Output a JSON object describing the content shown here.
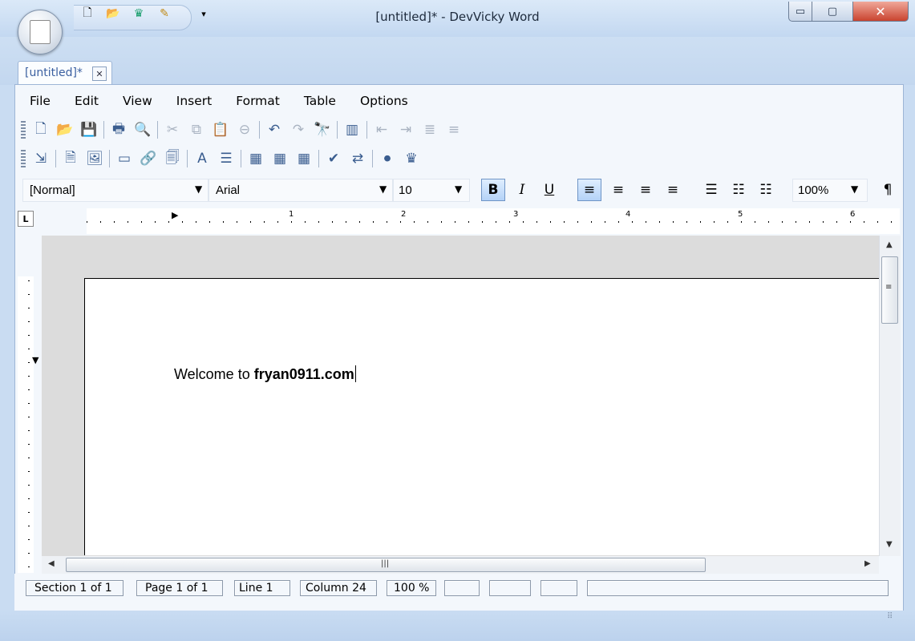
{
  "window": {
    "title": "[untitled]* - DevVicky Word",
    "buttons": {
      "minimize": "▭",
      "maximize": "▢",
      "close": "✕"
    }
  },
  "quick_access": {
    "icons": [
      "new-document-icon",
      "open-icon",
      "devvicky-logo-icon",
      "edit-icon",
      "customize-dropdown-icon"
    ],
    "glyphs": [
      "🗋",
      "📂",
      "♛",
      "✎",
      "▾"
    ]
  },
  "tabs": [
    {
      "label": "[untitled]*",
      "close": "✕"
    }
  ],
  "menu": {
    "items": [
      "File",
      "Edit",
      "View",
      "Insert",
      "Format",
      "Table",
      "Options"
    ]
  },
  "toolbar1": {
    "buttons": [
      {
        "name": "new-icon",
        "glyph": "🗋",
        "dim": false
      },
      {
        "name": "open-icon",
        "glyph": "📂",
        "dim": false
      },
      {
        "name": "save-icon",
        "glyph": "💾",
        "dim": false
      },
      {
        "name": "print-icon",
        "glyph": "🖶",
        "dim": false
      },
      {
        "name": "print-preview-icon",
        "glyph": "🔍",
        "dim": false
      },
      {
        "name": "cut-icon",
        "glyph": "✂",
        "dim": true
      },
      {
        "name": "copy-icon",
        "glyph": "⧉",
        "dim": true
      },
      {
        "name": "paste-icon",
        "glyph": "📋",
        "dim": false
      },
      {
        "name": "delete-icon",
        "glyph": "⊖",
        "dim": true
      },
      {
        "name": "undo-icon",
        "glyph": "↶",
        "dim": false
      },
      {
        "name": "redo-icon",
        "glyph": "↷",
        "dim": true
      },
      {
        "name": "find-icon",
        "glyph": "🔭",
        "dim": false
      },
      {
        "name": "columns-icon",
        "glyph": "▥",
        "dim": false
      },
      {
        "name": "indent-icon",
        "glyph": "⇤",
        "dim": true
      },
      {
        "name": "outdent-icon",
        "glyph": "⇥",
        "dim": true
      },
      {
        "name": "list-level-up-icon",
        "glyph": "≣",
        "dim": true
      },
      {
        "name": "list-level-down-icon",
        "glyph": "≡",
        "dim": true
      }
    ]
  },
  "toolbar2": {
    "buttons": [
      {
        "name": "insert-file-icon",
        "glyph": "⇲",
        "dim": false
      },
      {
        "name": "insert-page-icon",
        "glyph": "🗎",
        "dim": false
      },
      {
        "name": "insert-image-icon",
        "glyph": "🖼",
        "dim": false
      },
      {
        "name": "insert-textbox-icon",
        "glyph": "▭",
        "dim": false
      },
      {
        "name": "insert-link-icon",
        "glyph": "🔗",
        "dim": false
      },
      {
        "name": "insert-object-icon",
        "glyph": "🗐",
        "dim": false
      },
      {
        "name": "font-icon",
        "glyph": "A",
        "dim": false
      },
      {
        "name": "paragraph-icon",
        "glyph": "☰",
        "dim": false
      },
      {
        "name": "color-grid-1-icon",
        "glyph": "▦",
        "dim": false
      },
      {
        "name": "color-grid-2-icon",
        "glyph": "▦",
        "dim": false
      },
      {
        "name": "color-grid-3-icon",
        "glyph": "▦",
        "dim": false
      },
      {
        "name": "spellcheck-icon",
        "glyph": "✔",
        "dim": false
      },
      {
        "name": "translate-icon",
        "glyph": "⇄",
        "dim": false
      },
      {
        "name": "record-macro-icon",
        "glyph": "⏺",
        "dim": false
      },
      {
        "name": "devvicky-logo-icon",
        "glyph": "♛",
        "dim": false
      }
    ]
  },
  "format": {
    "style": "[Normal]",
    "font": "Arial",
    "size": "10",
    "zoom": "100%",
    "bold": "B",
    "italic": "I",
    "underline": "U",
    "pilcrow": "¶",
    "dropdown": "▼",
    "align_glyphs": [
      "≡",
      "≡",
      "≡",
      "≡"
    ],
    "list_glyphs": [
      "☰",
      "☷",
      "☷"
    ]
  },
  "ruler": {
    "corner": "L",
    "numbers": [
      "1",
      "2",
      "3",
      "4",
      "5",
      "6"
    ]
  },
  "document": {
    "text_plain": "Welcome to ",
    "text_bold": "fryan0911.com"
  },
  "scroll": {
    "up": "▲",
    "down": "▼",
    "left": "◀",
    "right": "▶",
    "grip": "≡",
    "hgrip": "|||"
  },
  "status": {
    "section": "Section 1 of 1",
    "page": "Page 1 of 1",
    "line": "Line 1",
    "column": "Column 24",
    "zoom": "100 %",
    "grip": "⠿"
  },
  "colors": {
    "frame": "#c9dcf2",
    "active_button": "#b4d2f7",
    "tab_text": "#3a5fa0"
  }
}
